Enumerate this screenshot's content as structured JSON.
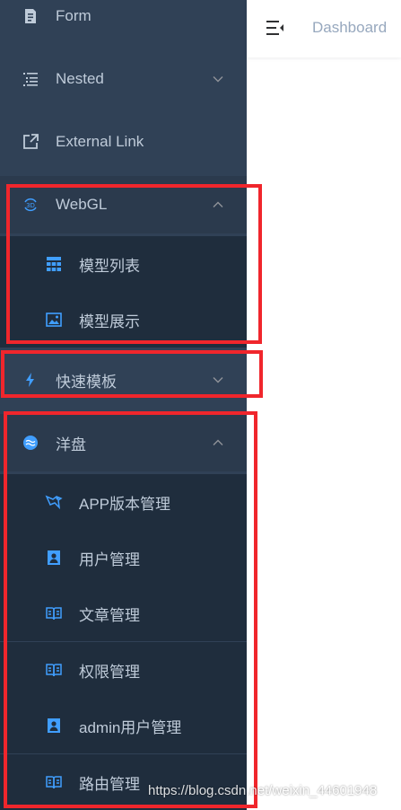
{
  "sidebar": {
    "items": [
      {
        "label": "Form",
        "icon": "form-icon"
      },
      {
        "label": "Nested",
        "icon": "nested-list-icon",
        "arrow": "chevron-down-icon"
      },
      {
        "label": "External Link",
        "icon": "external-link-icon"
      },
      {
        "label": "WebGL",
        "icon": "3d-icon",
        "arrow": "chevron-up-icon"
      },
      {
        "label": "快速模板",
        "icon": "lightning-icon",
        "arrow": "chevron-down-icon"
      },
      {
        "label": "洋盘",
        "icon": "wave-circle-icon",
        "arrow": "chevron-up-icon"
      }
    ],
    "webgl_children": [
      {
        "label": "模型列表",
        "icon": "grid-icon"
      },
      {
        "label": "模型展示",
        "icon": "image-icon"
      }
    ],
    "yangpan_children": [
      {
        "label": "APP版本管理",
        "icon": "bird-icon"
      },
      {
        "label": "用户管理",
        "icon": "user-card-icon"
      },
      {
        "label": "文章管理",
        "icon": "book-icon"
      },
      {
        "label": "权限管理",
        "icon": "book-icon"
      },
      {
        "label": "admin用户管理",
        "icon": "user-card-icon"
      },
      {
        "label": "路由管理",
        "icon": "book-icon"
      }
    ]
  },
  "navbar": {
    "breadcrumb": "Dashboard",
    "toggle_icon": "hamburger-icon"
  },
  "watermark": "https://blog.csdn.net/weixin_44601948",
  "colors": {
    "sidebar_bg": "#304156",
    "submenu_bg": "#1f2d3d",
    "menu_text": "#bfcbd9",
    "icon_blue": "#409eff",
    "highlight_red": "#f0262c"
  }
}
